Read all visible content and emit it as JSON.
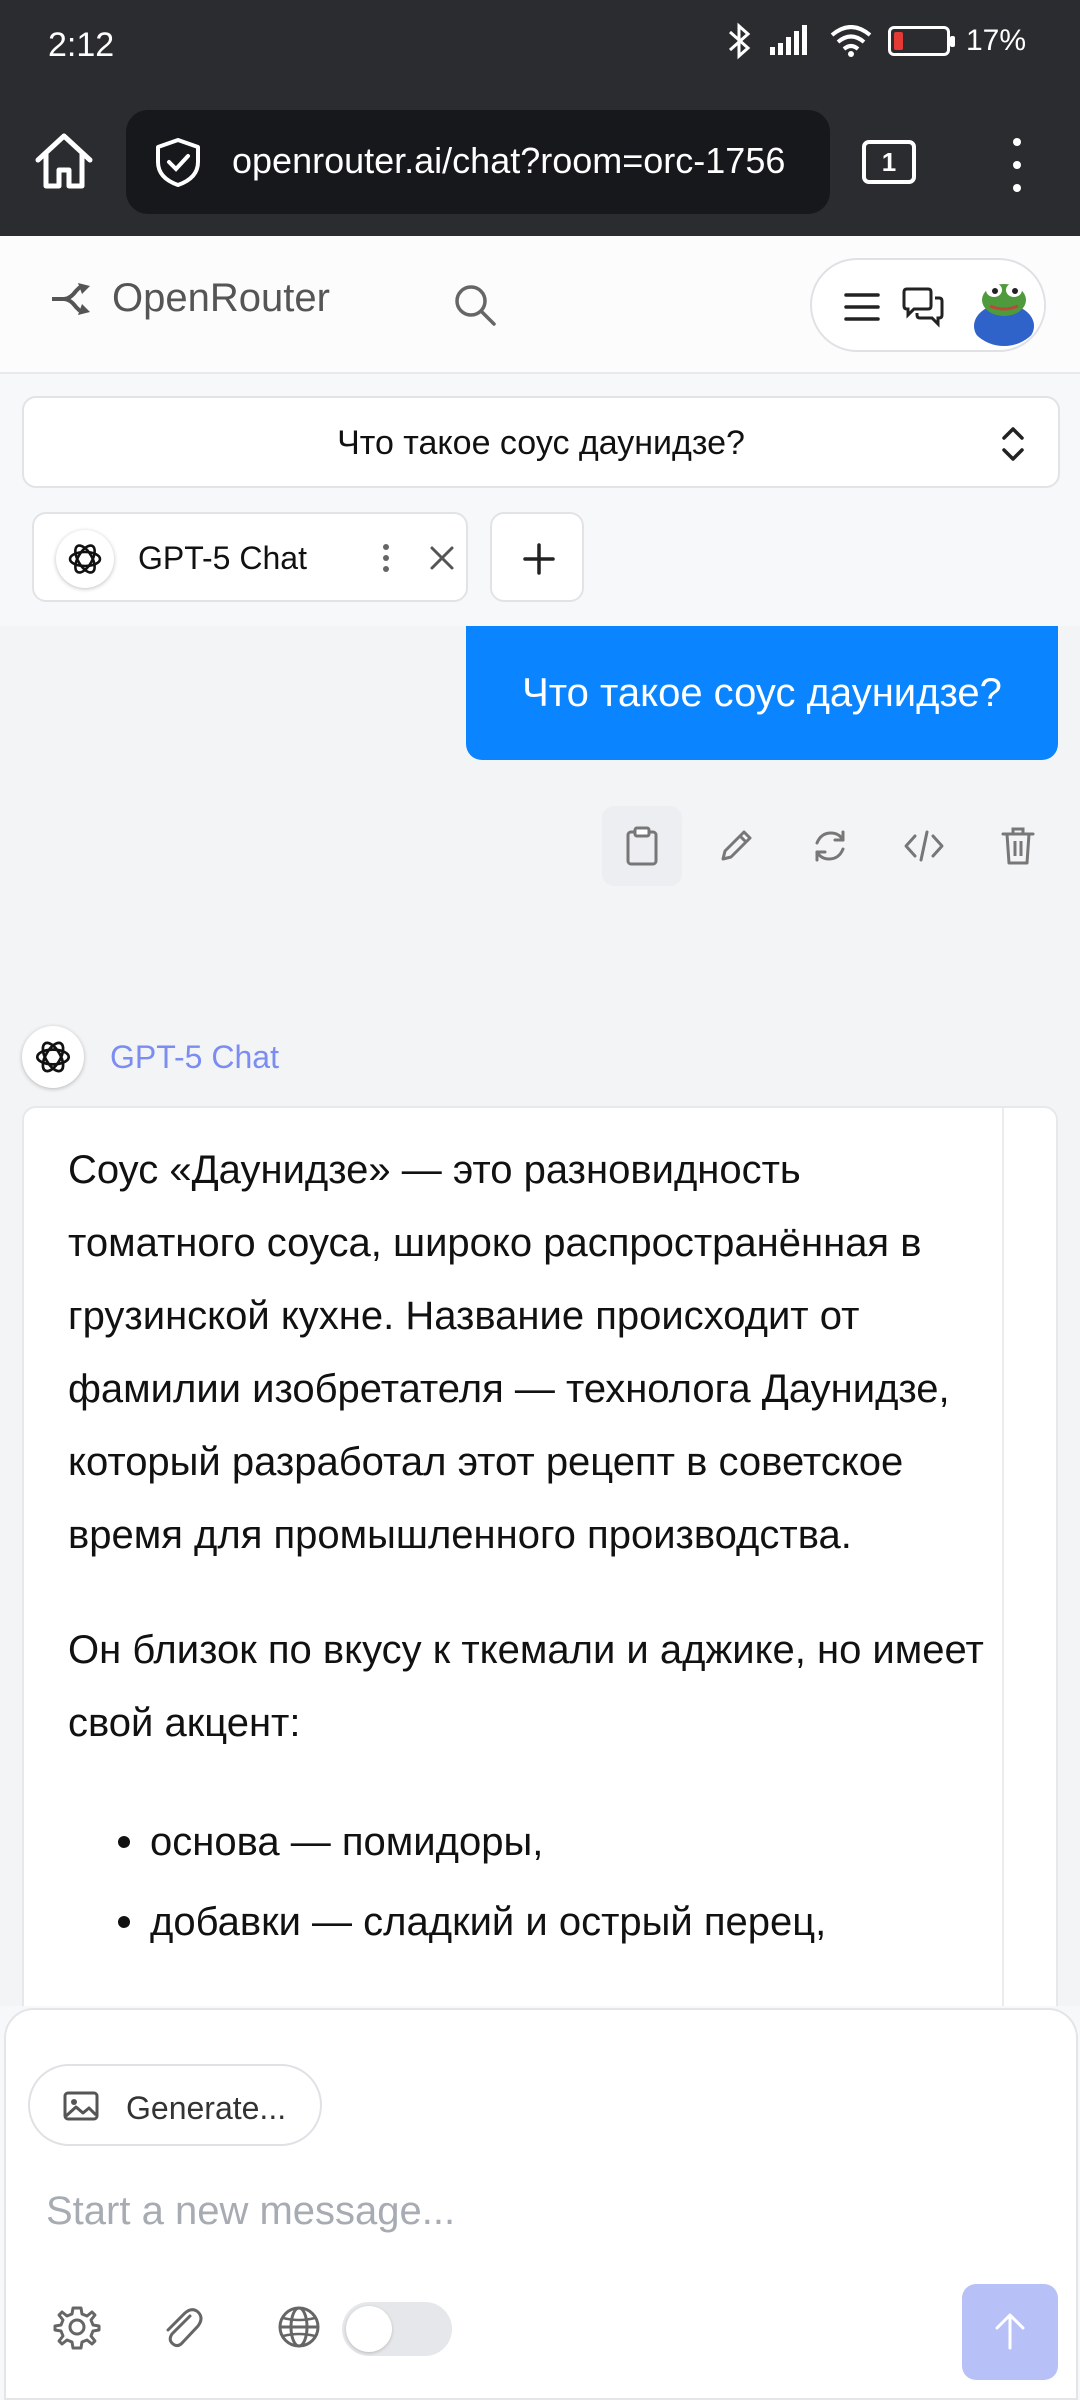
{
  "status_bar": {
    "time": "2:12",
    "battery_text": "17%",
    "battery_level": 0.17,
    "icons": [
      "bluetooth-icon",
      "signal-icon",
      "wifi-icon",
      "battery-icon"
    ]
  },
  "browser": {
    "url": "openrouter.ai/chat?room=orc-1756",
    "tab_count": "1"
  },
  "site_header": {
    "brand": "OpenRouter"
  },
  "chat": {
    "title": "Что такое соус даунидзе?",
    "model_tab_name": "GPT-5 Chat",
    "user_message": "Что такое соус даунидзе?",
    "assistant_name": "GPT-5 Chat",
    "answer_paragraphs": [
      "Соус «Даунидзе» — это разновидность томатного соуса, широко распространённая в грузинской кухне. Название происходит от фамилии изобретателя — технолога Даунидзе, который разработал этот рецепт в советское время для промышленного производства.",
      "Он близок по вкусу к ткемали и аджике, но имеет свой акцент:"
    ],
    "answer_list": [
      "основа — помидоры,",
      "добавки — сладкий и острый перец,"
    ]
  },
  "composer": {
    "generate_label": "Generate...",
    "placeholder": "Start a new message...",
    "web_search_enabled": false
  },
  "colors": {
    "user_bubble": "#0a84ff",
    "model_label": "#7b8df0",
    "send_button": "#b7c1f7"
  }
}
